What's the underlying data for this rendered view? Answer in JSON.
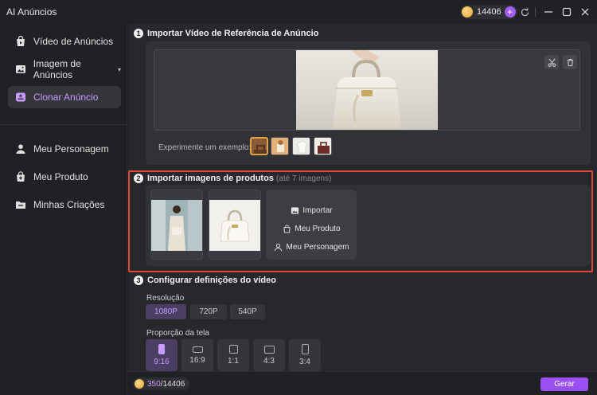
{
  "app": {
    "title": "AI Anúncios"
  },
  "header": {
    "credits": "14406",
    "add_label": "+"
  },
  "sidebar": {
    "items": [
      {
        "label": "Vídeo de Anúncios",
        "icon": "video-bag-icon"
      },
      {
        "label": "Imagem de Anúncios",
        "icon": "image-ad-icon"
      },
      {
        "label": "Clonar Anúncio",
        "icon": "clone-ad-icon",
        "active": true
      },
      {
        "label": "Meu Personagem",
        "icon": "person-icon"
      },
      {
        "label": "Meu Produto",
        "icon": "product-bag-icon"
      },
      {
        "label": "Minhas Criações",
        "icon": "folder-icon"
      }
    ]
  },
  "step1": {
    "num": "1",
    "title": "Importar Vídeo de Referência de Anúncio",
    "examples_label": "Experimente um exemplo:"
  },
  "step2": {
    "num": "2",
    "title": "Importar imagens de produtos",
    "hint": "(até 7 imagens)",
    "import_label": "Importar",
    "my_product_label": "Meu Produto",
    "my_character_label": "Meu Personagem"
  },
  "step3": {
    "num": "3",
    "title": "Configurar definições do vídeo",
    "resolution_label": "Resolução",
    "resolutions": [
      "1080P",
      "720P",
      "540P"
    ],
    "selected_resolution": "1080P",
    "ratio_label": "Proporção da tela",
    "ratios": [
      "9:16",
      "16:9",
      "1:1",
      "4:3",
      "3:4"
    ],
    "selected_ratio": "9:16"
  },
  "footer": {
    "cost_used": "350",
    "cost_total": "/14406",
    "generate_label": "Gerar"
  },
  "colors": {
    "accent": "#9a4ff2",
    "highlight_border": "#e0493a",
    "coin": "#e5a42e"
  }
}
